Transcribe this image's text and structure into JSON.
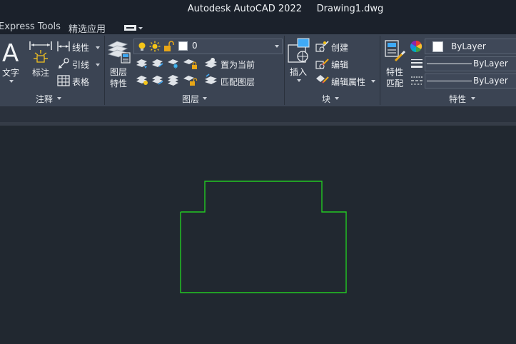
{
  "window": {
    "title": "Autodesk AutoCAD 2022     Drawing1.dwg"
  },
  "menu_tabs": [
    {
      "label": "Express Tools"
    },
    {
      "label": "精选应用"
    }
  ],
  "annotation_panel": {
    "title": "注释",
    "text_label": "文字",
    "dimension_label": "标注",
    "linear_label": "线性",
    "leader_label": "引线",
    "table_label": "表格"
  },
  "layers_panel": {
    "title": "图层",
    "layer_properties_label": "图层\n特性",
    "current_layer": "0",
    "set_current_label": "置为当前",
    "match_layer_label": "匹配图层"
  },
  "block_panel": {
    "title": "块",
    "insert_label": "插入",
    "create_label": "创建",
    "edit_label": "编辑",
    "edit_attributes_label": "编辑属性"
  },
  "properties_panel": {
    "title": "特性",
    "match_properties_label": "特性\n匹配",
    "color_value": "ByLayer",
    "lineweight_value": "ByLayer",
    "linetype_value": "ByLayer"
  },
  "colors": {
    "accent_green": "#22c822",
    "canvas_bg": "#212830"
  }
}
